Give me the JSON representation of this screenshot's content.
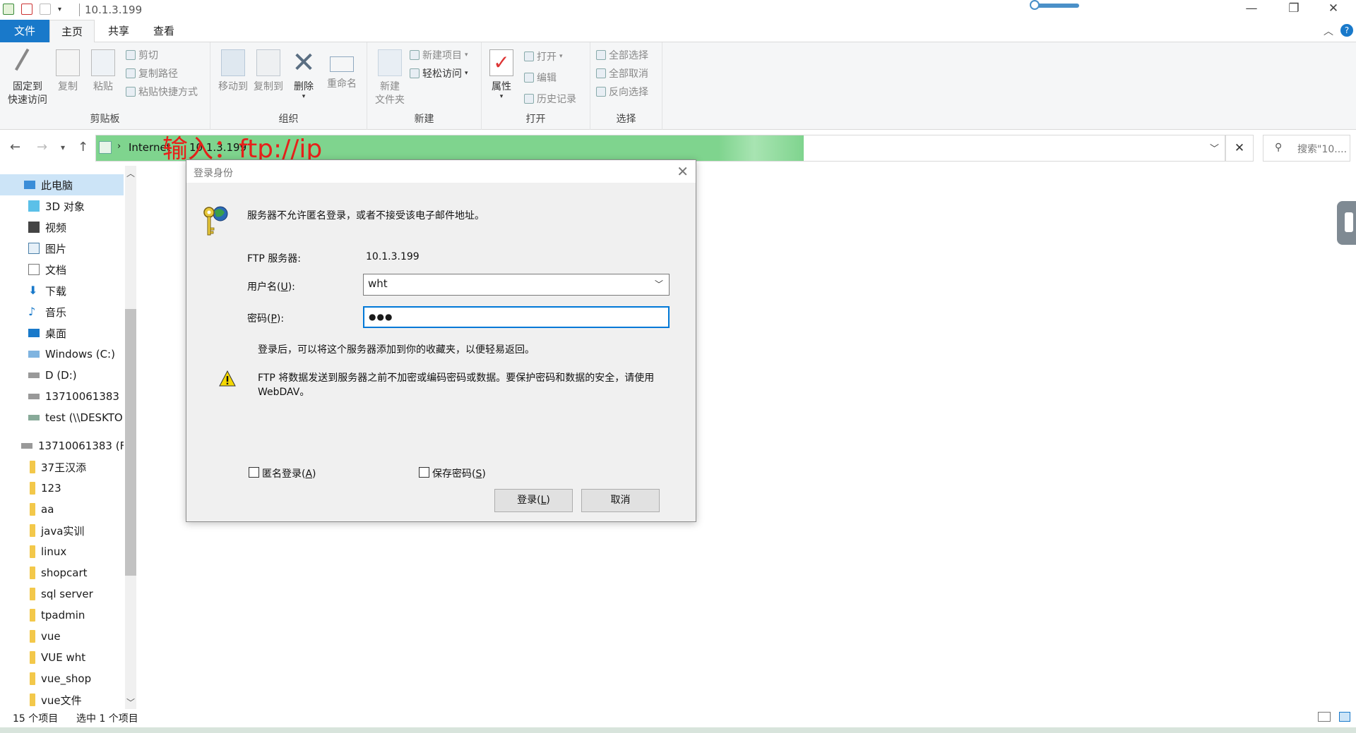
{
  "window": {
    "title": "10.1.3.199",
    "controls": {
      "minimize": "—",
      "maximize": "❐",
      "close": "✕"
    },
    "zoom_level": 0.55
  },
  "ribbon_tabs": [
    {
      "label": "文件"
    },
    {
      "label": "主页"
    },
    {
      "label": "共享"
    },
    {
      "label": "查看"
    }
  ],
  "ribbon": {
    "clipboard": {
      "pin_label_1": "固定到",
      "pin_label_2": "快速访问",
      "copy_label": "复制",
      "paste_label": "粘贴",
      "cut_label": "剪切",
      "copy_path_label": "复制路径",
      "paste_shortcut_label": "粘贴快捷方式",
      "group_label": "剪贴板"
    },
    "organize": {
      "move_label": "移动到",
      "copyto_label": "复制到",
      "delete_label": "删除",
      "rename_label": "重命名",
      "group_label": "组织"
    },
    "new": {
      "newfolder_label_1": "新建",
      "newfolder_label_2": "文件夹",
      "newitem_label": "新建项目",
      "easyaccess_label": "轻松访问",
      "group_label": "新建"
    },
    "open": {
      "properties_label": "属性",
      "open_label": "打开",
      "edit_label": "编辑",
      "history_label": "历史记录",
      "group_label": "打开"
    },
    "select": {
      "selectall_label": "全部选择",
      "selectnone_label": "全部取消",
      "invert_label": "反向选择",
      "group_label": "选择"
    }
  },
  "addressbar": {
    "crumb": "Internet",
    "ip": "10.1.3.199",
    "search_placeholder": "搜索\"10...."
  },
  "annotation": "输入：ftp://ip",
  "sidebar": {
    "items": [
      {
        "label": "此电脑",
        "icon": "computer-icon"
      },
      {
        "label": "3D 对象",
        "icon": "cube-icon"
      },
      {
        "label": "视频",
        "icon": "video-icon"
      },
      {
        "label": "图片",
        "icon": "picture-icon"
      },
      {
        "label": "文档",
        "icon": "document-icon"
      },
      {
        "label": "下载",
        "icon": "download-icon"
      },
      {
        "label": "音乐",
        "icon": "music-icon"
      },
      {
        "label": "桌面",
        "icon": "desktop-icon"
      },
      {
        "label": "Windows (C:)",
        "icon": "drive-icon"
      },
      {
        "label": "D (D:)",
        "icon": "drive-icon"
      },
      {
        "label": "13710061383 (",
        "icon": "drive-icon"
      },
      {
        "label": "test (\\\\DESKTO",
        "icon": "network-drive-icon"
      },
      {
        "label": "13710061383 (F:",
        "icon": "drive-icon"
      },
      {
        "label": "37王汉添",
        "icon": "folder-icon"
      },
      {
        "label": "123",
        "icon": "folder-icon"
      },
      {
        "label": "aa",
        "icon": "folder-icon"
      },
      {
        "label": "java实训",
        "icon": "folder-icon"
      },
      {
        "label": "linux",
        "icon": "folder-icon"
      },
      {
        "label": "shopcart",
        "icon": "folder-icon"
      },
      {
        "label": "sql server",
        "icon": "folder-icon"
      },
      {
        "label": "tpadmin",
        "icon": "folder-icon"
      },
      {
        "label": "vue",
        "icon": "folder-icon"
      },
      {
        "label": "VUE wht",
        "icon": "folder-icon"
      },
      {
        "label": "vue_shop",
        "icon": "folder-icon"
      },
      {
        "label": "vue文件",
        "icon": "folder-icon"
      }
    ]
  },
  "status": {
    "item_count": "15 个项目",
    "selected": "选中 1 个项目"
  },
  "dialog": {
    "title": "登录身份",
    "message": "服务器不允许匿名登录，或者不接受该电子邮件地址。",
    "server_label": "FTP 服务器:",
    "server_value": "10.1.3.199",
    "username_label": "用户名",
    "username_mnemonic": "U",
    "username_value": "wht",
    "password_label": "密码",
    "password_mnemonic": "P",
    "password_value": "●●●",
    "info_text": "登录后，可以将这个服务器添加到你的收藏夹，以便轻易返回。",
    "warning_line1": "FTP 将数据发送到服务器之前不加密或编码密码或数据。要保护密码和数据的安全，请使用",
    "warning_line2": "WebDAV。",
    "anonymous_label": "匿名登录",
    "anonymous_mnemonic": "A",
    "save_password_label": "保存密码",
    "save_password_mnemonic": "S",
    "login_label": "登录",
    "login_mnemonic": "L",
    "cancel_label": "取消"
  }
}
